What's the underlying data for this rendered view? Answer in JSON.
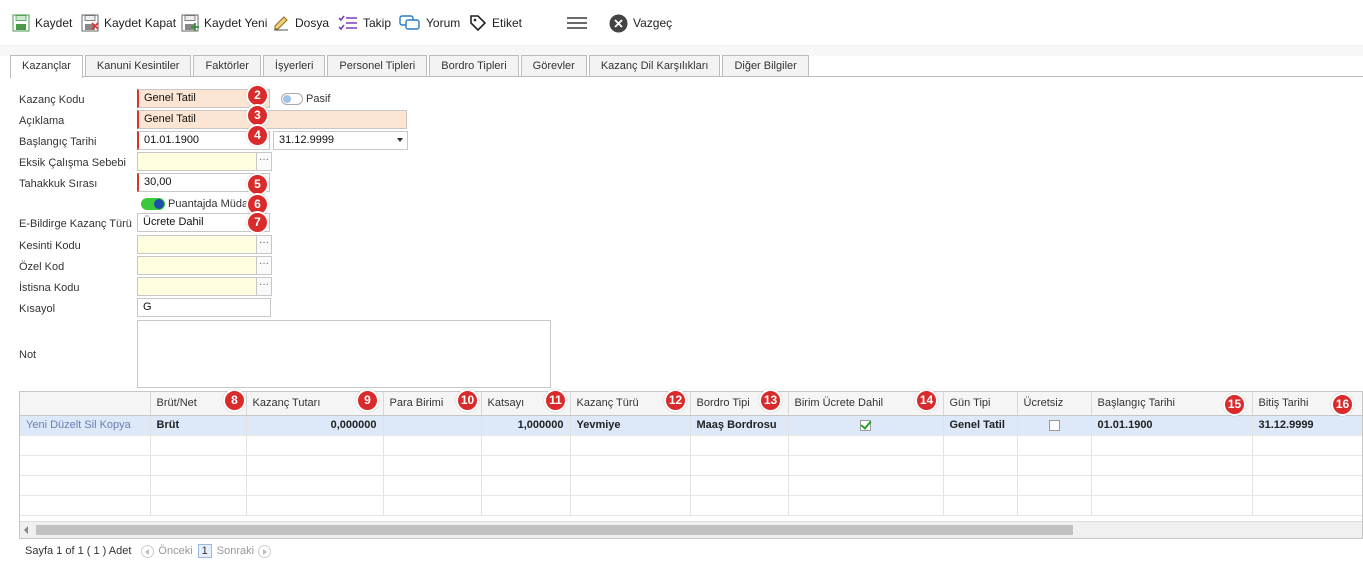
{
  "toolbar": {
    "save": "Kaydet",
    "save_close": "Kaydet Kapat",
    "save_new": "Kaydet Yeni",
    "file": "Dosya",
    "follow": "Takip",
    "comment": "Yorum",
    "tag": "Etiket",
    "cancel": "Vazgeç"
  },
  "tabs": [
    "Kazançlar",
    "Kanuni Kesintiler",
    "Faktörler",
    "İşyerleri",
    "Personel Tipleri",
    "Bordro Tipleri",
    "Görevler",
    "Kazanç Dil Karşılıkları",
    "Diğer Bilgiler"
  ],
  "form": {
    "kazanc_kodu": {
      "label": "Kazanç Kodu",
      "value": "Genel Tatil"
    },
    "pasif": {
      "label": "Pasif"
    },
    "aciklama": {
      "label": "Açıklama",
      "value": "Genel Tatil"
    },
    "baslangic_tarihi": {
      "label": "Başlangıç Tarihi",
      "value": "01.01.1900",
      "end_value": "31.12.9999"
    },
    "eksik_calisma_sebebi": {
      "label": "Eksik Çalışma Sebebi",
      "value": ""
    },
    "tahakkuk_sirasi": {
      "label": "Tahakkuk Sırası",
      "value": "30,00"
    },
    "puantajda_mudahale": {
      "label": "Puantajda Müdahale"
    },
    "ebildirge_kazanc_turu": {
      "label": "E-Bildirge Kazanç Türü",
      "value": "Ücrete Dahil"
    },
    "kesinti_kodu": {
      "label": "Kesinti Kodu",
      "value": ""
    },
    "ozel_kod": {
      "label": "Özel Kod",
      "value": ""
    },
    "istisna_kodu": {
      "label": "İstisna Kodu",
      "value": ""
    },
    "kisayol": {
      "label": "Kısayol",
      "value": "G"
    },
    "not": {
      "label": "Not",
      "value": ""
    },
    "lookup_glyph": "···"
  },
  "badges": [
    "2",
    "3",
    "4",
    "5",
    "6",
    "7",
    "8",
    "9",
    "10",
    "11",
    "12",
    "13",
    "14",
    "15",
    "16"
  ],
  "grid": {
    "columns": [
      "",
      "Brüt/Net",
      "Kazanç Tutarı",
      "Para Birimi",
      "Katsayı",
      "Kazanç Türü",
      "Bordro Tipi",
      "Birim Ücrete Dahil",
      "Gün Tipi",
      "Ücretsiz",
      "Başlangıç Tarihi",
      "Bitiş Tarihi"
    ],
    "row": {
      "commands": "Yeni Düzelt Sil Kopya",
      "brut_net": "Brüt",
      "tutar": "0,000000",
      "para_birimi": "",
      "katsayi": "1,000000",
      "kazanc_turu": "Yevmiye",
      "bordro_tipi": "Maaş Bordrosu",
      "birim_ucrete_dahil": true,
      "gun_tipi": "Genel Tatil",
      "ucretsiz": false,
      "baslangic": "01.01.1900",
      "bitis": "31.12.9999"
    }
  },
  "pager": {
    "info": "Sayfa 1 of 1 ( 1 ) Adet",
    "prev": "Önceki",
    "page": "1",
    "next": "Sonraki"
  },
  "colors": {
    "required": "#d9362b",
    "peach": "#fde5d3",
    "lookup_yellow": "#fffde0",
    "badge": "#d92b2b",
    "selected_row": "#dde8f8"
  }
}
